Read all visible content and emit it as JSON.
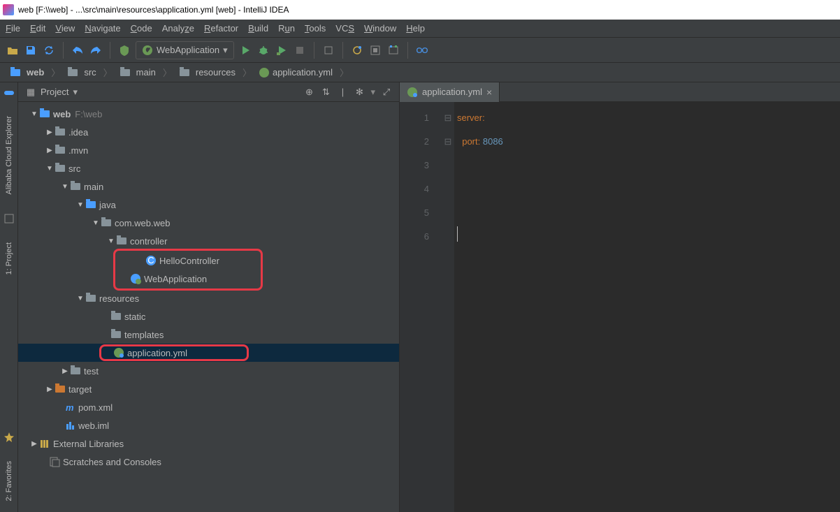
{
  "title": "web [F:\\\\web] - ...\\src\\main\\resources\\application.yml [web] - IntelliJ IDEA",
  "menu": [
    "File",
    "Edit",
    "View",
    "Navigate",
    "Code",
    "Analyze",
    "Refactor",
    "Build",
    "Run",
    "Tools",
    "VCS",
    "Window",
    "Help"
  ],
  "runConfig": "WebApplication",
  "breadcrumbs": [
    "web",
    "src",
    "main",
    "resources",
    "application.yml"
  ],
  "projectPanel": {
    "title": "Project"
  },
  "panelIcons": {
    "target": "⊕",
    "autoscroll": "⇅",
    "settings": "✻",
    "hide": "⤢"
  },
  "rail": {
    "cloud": "Alibaba Cloud Explorer",
    "project": "1: Project",
    "favorites": "2: Favorites"
  },
  "tree": {
    "root": {
      "name": "web",
      "path": "F:\\web"
    },
    "idea": ".idea",
    "mvn": ".mvn",
    "src": "src",
    "main": "main",
    "java": "java",
    "pkg": "com.web.web",
    "controller": "controller",
    "hello": "HelloController",
    "app": "WebApplication",
    "resources": "resources",
    "static": "static",
    "templates": "templates",
    "yml": "application.yml",
    "test": "test",
    "target": "target",
    "pom": "pom.xml",
    "iml": "web.iml",
    "extlib": "External Libraries",
    "scratch": "Scratches and Consoles"
  },
  "editor": {
    "tabName": "application.yml",
    "lines": [
      "1",
      "2",
      "3",
      "4",
      "5",
      "6"
    ],
    "code": {
      "l1_key": "server:",
      "l2_key": "  port: ",
      "l2_val": "8086"
    }
  }
}
